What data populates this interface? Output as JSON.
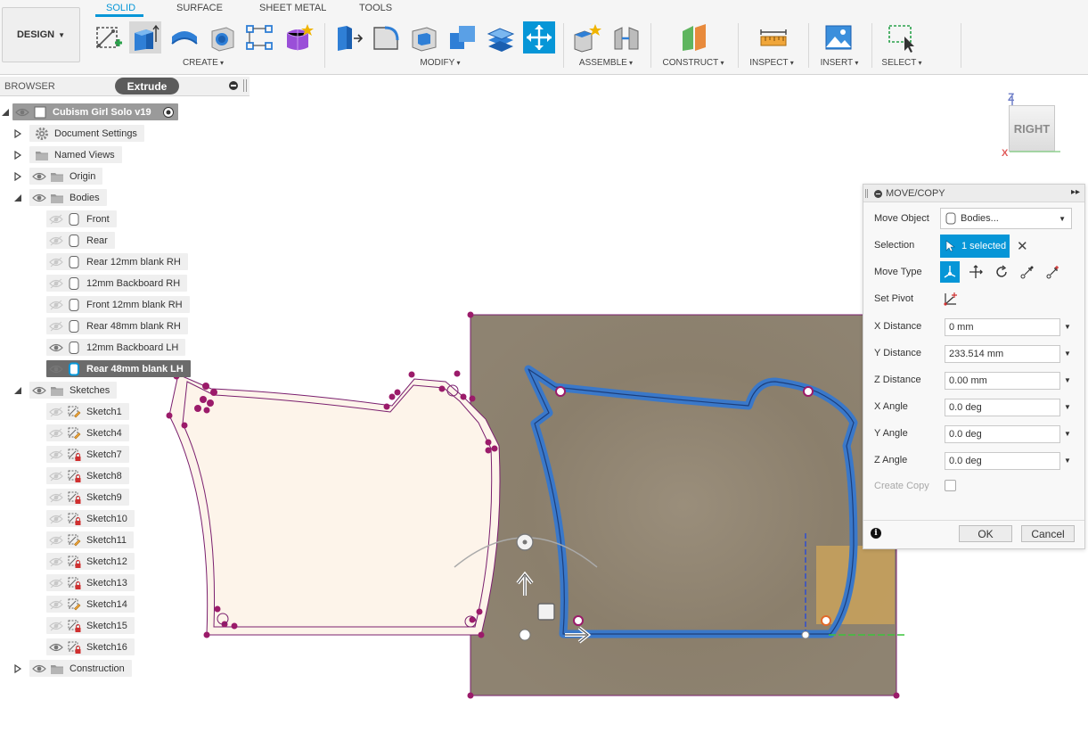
{
  "toolbar": {
    "design_label": "DESIGN",
    "tabs": [
      "SOLID",
      "SURFACE",
      "SHEET METAL",
      "TOOLS"
    ],
    "groups": [
      "CREATE",
      "MODIFY",
      "ASSEMBLE",
      "CONSTRUCT",
      "INSPECT",
      "INSERT",
      "SELECT"
    ],
    "active_tool": "move-copy"
  },
  "browser": {
    "title": "BROWSER",
    "tooltip": "Extrude",
    "root": "Cubism Girl Solo v19",
    "folders": {
      "document_settings": "Document Settings",
      "named_views": "Named Views",
      "origin": "Origin",
      "bodies": "Bodies",
      "sketches": "Sketches",
      "construction": "Construction"
    },
    "bodies": [
      {
        "label": "Front",
        "visible": false
      },
      {
        "label": "Rear",
        "visible": false
      },
      {
        "label": "Rear 12mm blank RH",
        "visible": false
      },
      {
        "label": "12mm Backboard RH",
        "visible": false
      },
      {
        "label": "Front 12mm blank RH",
        "visible": false
      },
      {
        "label": "Rear 48mm blank RH",
        "visible": false
      },
      {
        "label": "12mm Backboard LH",
        "visible": true
      },
      {
        "label": "Rear 48mm blank LH",
        "visible": true,
        "selected": true
      }
    ],
    "sketches": [
      {
        "label": "Sketch1",
        "visible": false
      },
      {
        "label": "Sketch4",
        "visible": false
      },
      {
        "label": "Sketch7",
        "visible": false
      },
      {
        "label": "Sketch8",
        "visible": false
      },
      {
        "label": "Sketch9",
        "visible": false
      },
      {
        "label": "Sketch10",
        "visible": false
      },
      {
        "label": "Sketch11",
        "visible": false
      },
      {
        "label": "Sketch12",
        "visible": false
      },
      {
        "label": "Sketch13",
        "visible": false
      },
      {
        "label": "Sketch14",
        "visible": false
      },
      {
        "label": "Sketch15",
        "visible": false
      },
      {
        "label": "Sketch16",
        "visible": true
      }
    ]
  },
  "viewcube": {
    "face": "RIGHT",
    "axis_z": "Z",
    "axis_x": "X"
  },
  "panel": {
    "title": "MOVE/COPY",
    "move_object_label": "Move Object",
    "move_object_value": "Bodies...",
    "selection_label": "Selection",
    "selection_value": "1 selected",
    "move_type_label": "Move Type",
    "set_pivot_label": "Set Pivot",
    "fields": [
      {
        "label": "X Distance",
        "value": "0 mm"
      },
      {
        "label": "Y Distance",
        "value": "233.514 mm"
      },
      {
        "label": "Z Distance",
        "value": "0.00 mm"
      },
      {
        "label": "X Angle",
        "value": "0.0 deg"
      },
      {
        "label": "Y Angle",
        "value": "0.0 deg"
      },
      {
        "label": "Z Angle",
        "value": "0.0 deg"
      }
    ],
    "create_copy_label": "Create Copy",
    "create_copy_checked": false,
    "ok_label": "OK",
    "cancel_label": "Cancel"
  },
  "colors": {
    "accent": "#0696d7",
    "body_fill": "#8c806d",
    "profile_blue": "#3a78c9",
    "sketch_line": "#7a1f6e",
    "sketch_point": "#9b1b6a",
    "ghost_fill": "#fdf4ea",
    "highlight_box": "#c9a25c"
  }
}
